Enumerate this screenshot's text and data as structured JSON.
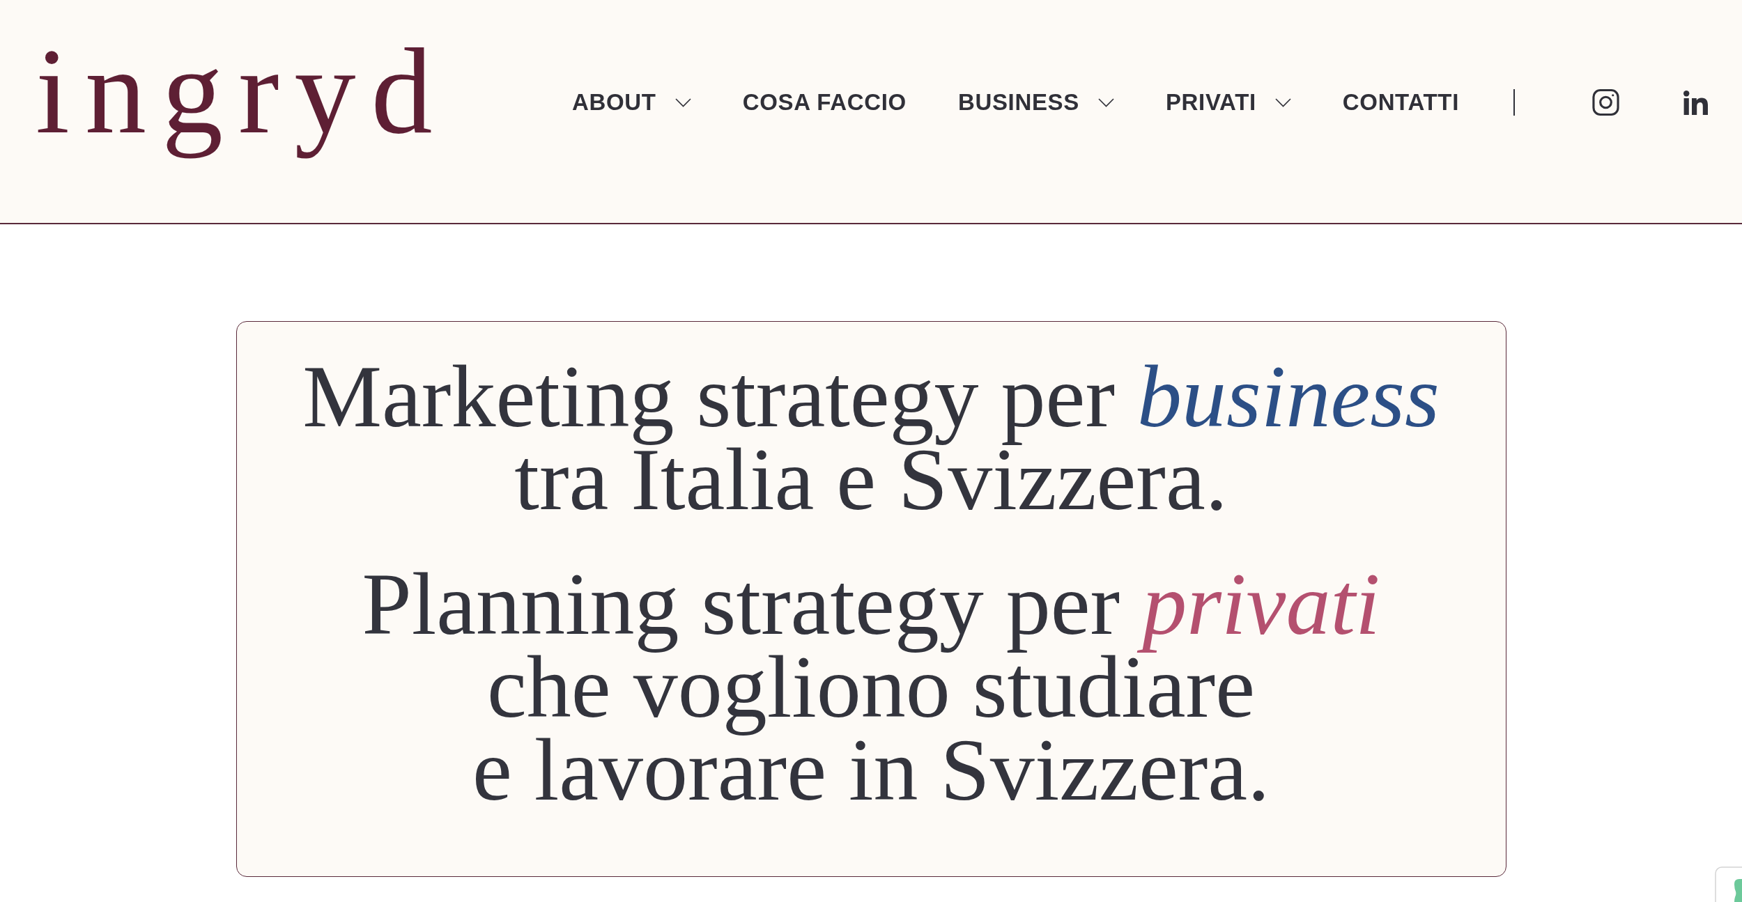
{
  "header": {
    "logo": "ingryd",
    "nav": [
      {
        "label": "ABOUT",
        "dropdown": true
      },
      {
        "label": "COSA FACCIO",
        "dropdown": false
      },
      {
        "label": "BUSINESS",
        "dropdown": true
      },
      {
        "label": "PRIVATI",
        "dropdown": true
      },
      {
        "label": "CONTATTI",
        "dropdown": false
      }
    ]
  },
  "hero": {
    "headlines": [
      {
        "lines": [
          "Marketing strategy per *business*",
          "tra Italia e Svizzera."
        ],
        "color": "#2c4f86"
      },
      {
        "lines": [
          "Planning strategy per *privati*",
          "che vogliono studiare",
          "e lavorare in Svizzera."
        ],
        "color": "#b4506f"
      }
    ]
  }
}
